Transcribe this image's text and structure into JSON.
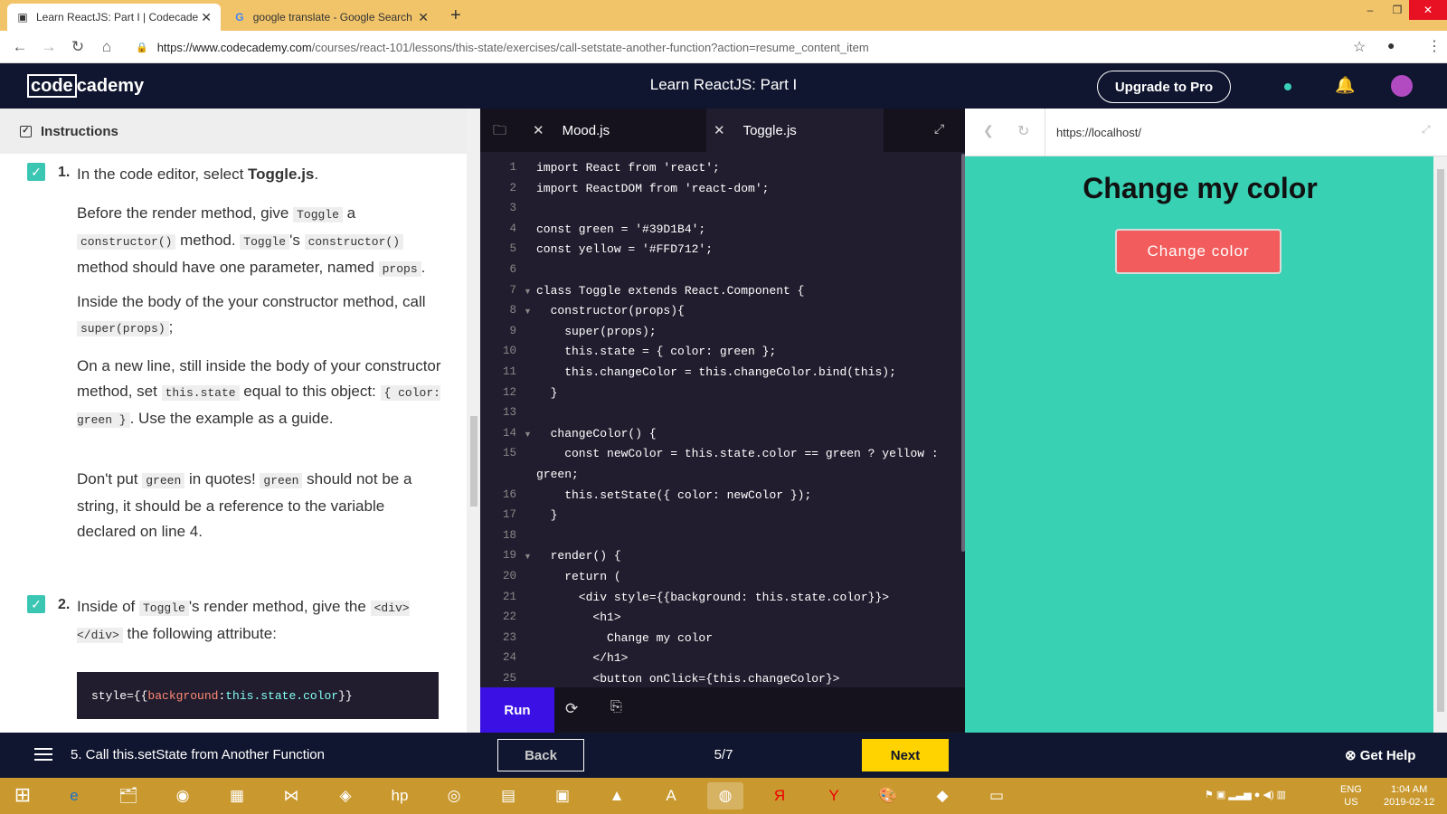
{
  "browser": {
    "tabs": [
      {
        "title": "Learn ReactJS: Part I | Codecadem",
        "active": true
      },
      {
        "title": "google translate - Google Search",
        "active": false
      }
    ],
    "url_host": "https://www.codecademy.com",
    "url_path": "/courses/react-101/lessons/this-state/exercises/call-setstate-another-function?action=resume_content_item"
  },
  "header": {
    "logo_left": "code",
    "logo_right": "cademy",
    "course_title": "Learn ReactJS: Part I",
    "upgrade_label": "Upgrade to Pro"
  },
  "instructions": {
    "heading": "Instructions",
    "step1": {
      "num": "1.",
      "intro_a": "In the code editor, select ",
      "intro_b": "Toggle.js",
      "intro_c": ".",
      "p1_a": "Before the render method, give ",
      "p1_c1": "Toggle",
      "p1_b": " a ",
      "p1_c2": "constructor()",
      "p1_c": " method. ",
      "p1_c3": "Toggle",
      "p1_d": "'s ",
      "p1_c4": "constructor()",
      "p1_e": " method should have one parameter, named ",
      "p1_c5": "props",
      "p1_f": ".",
      "p2_a": "Inside the body of the your constructor method, call ",
      "p2_c1": "super(props)",
      "p2_b": ";",
      "p3_a": "On a new line, still inside the body of your constructor method, set ",
      "p3_c1": "this.state",
      "p3_b": " equal to this object: ",
      "p3_c2": "{ color: green }",
      "p3_c": ". Use the example as a guide.",
      "p4_c1": "green",
      "p4_a": "Don't put ",
      "p4_b": " in quotes! ",
      "p4_c2": "green",
      "p4_c": " should not be a string, it should be a reference to the variable declared on line 4."
    },
    "step2": {
      "num": "2.",
      "a": "Inside of ",
      "c1": "Toggle",
      "b": "'s render method, give the ",
      "c2": "<div></div>",
      "c": " the following attribute:",
      "snippet_a": "style={{",
      "snippet_b": "background",
      "snippet_c": ": ",
      "snippet_d": "this.state.color",
      "snippet_e": "}}"
    }
  },
  "editor": {
    "tabs": [
      {
        "name": "Mood.js",
        "active": false
      },
      {
        "name": "Toggle.js",
        "active": true
      }
    ],
    "lines": [
      {
        "n": "1",
        "t": "import React from 'react';"
      },
      {
        "n": "2",
        "t": "import ReactDOM from 'react-dom';"
      },
      {
        "n": "3",
        "t": ""
      },
      {
        "n": "4",
        "t": "const green = '#39D1B4';"
      },
      {
        "n": "5",
        "t": "const yellow = '#FFD712';"
      },
      {
        "n": "6",
        "t": ""
      },
      {
        "n": "7",
        "t": "class Toggle extends React.Component {"
      },
      {
        "n": "8",
        "t": "  constructor(props){"
      },
      {
        "n": "9",
        "t": "    super(props);"
      },
      {
        "n": "10",
        "t": "    this.state = { color: green };"
      },
      {
        "n": "11",
        "t": "    this.changeColor = this.changeColor.bind(this);"
      },
      {
        "n": "12",
        "t": "  }"
      },
      {
        "n": "13",
        "t": ""
      },
      {
        "n": "14",
        "t": "  changeColor() {"
      },
      {
        "n": "15",
        "t": "    const newColor = this.state.color == green ? yellow :"
      },
      {
        "n": "",
        "t": "green;"
      },
      {
        "n": "16",
        "t": "    this.setState({ color: newColor });"
      },
      {
        "n": "17",
        "t": "  }"
      },
      {
        "n": "18",
        "t": ""
      },
      {
        "n": "19",
        "t": "  render() {"
      },
      {
        "n": "20",
        "t": "    return ("
      },
      {
        "n": "21",
        "t": "      <div style={{background: this.state.color}}>"
      },
      {
        "n": "22",
        "t": "        <h1>"
      },
      {
        "n": "23",
        "t": "          Change my color"
      },
      {
        "n": "24",
        "t": "        </h1>"
      },
      {
        "n": "25",
        "t": "        <button onClick={this.changeColor}>"
      }
    ],
    "run_label": "Run"
  },
  "preview": {
    "url": "https://localhost/",
    "heading": "Change my color",
    "button_label": "Change color",
    "bg_color": "#39d1b4",
    "button_color": "#f25c5c"
  },
  "footer": {
    "lesson_title": "5. Call this.setState from Another Function",
    "back_label": "Back",
    "progress": "5/7",
    "next_label": "Next",
    "help_label": "Get Help"
  },
  "taskbar": {
    "lang_top": "ENG",
    "lang_bottom": "US",
    "time": "1:04 AM",
    "date": "2019-02-12"
  }
}
